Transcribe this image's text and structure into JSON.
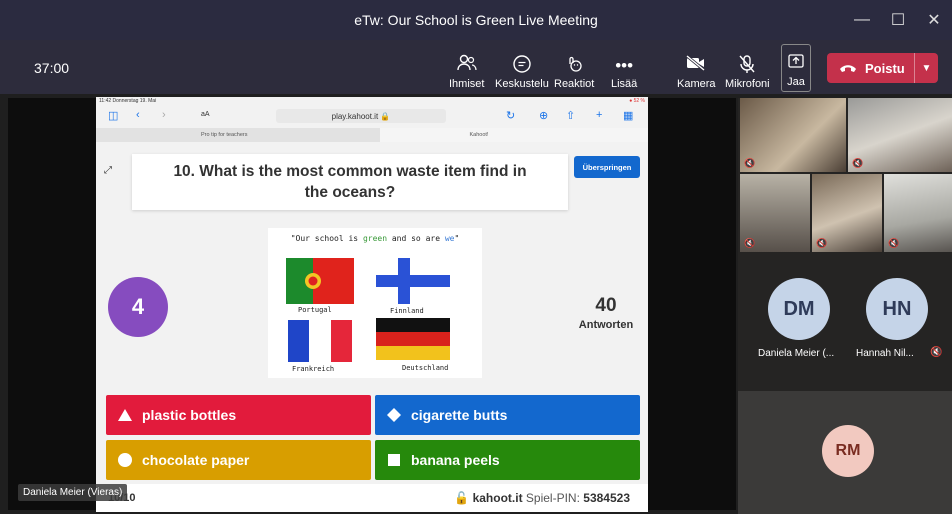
{
  "window": {
    "title": "eTw: Our School is Green Live Meeting",
    "controls": {
      "minimize": "—",
      "maximize": "☐",
      "close": "✕"
    }
  },
  "toolbar": {
    "timer": "37:00",
    "people_label": "Ihmiset",
    "chat_label": "Keskustelu",
    "reactions_label": "Reaktiot",
    "more_label": "Lisää",
    "camera_label": "Kamera",
    "mic_label": "Mikrofoni",
    "share_label": "Jaa",
    "leave_label": "Poistu"
  },
  "ipad": {
    "status_left": "11:42  Donnerstag 19. Mai",
    "status_right": "● 52 %",
    "aa": "aA",
    "url": "play.kahoot.it",
    "tab1": "Pro tip for teachers",
    "tab2": "Kahoot!"
  },
  "quiz": {
    "question": "10. What is the most common waste item find in the oceans?",
    "skip_label": "Überspringen",
    "timer_value": "4",
    "answers_count": "40",
    "answers_label": "Antworten",
    "image": {
      "caption_pre": "\"Our school is ",
      "caption_green": "green",
      "caption_mid": " and so are ",
      "caption_we": "we",
      "caption_post": "\"",
      "flags": [
        "Portugal",
        "Finnland",
        "Frankreich",
        "Deutschland"
      ]
    },
    "answers": [
      {
        "label": "plastic bottles",
        "color": "#e21b3c",
        "shape": "triangle"
      },
      {
        "label": "cigarette butts",
        "color": "#1368ce",
        "shape": "diamond"
      },
      {
        "label": "chocolate paper",
        "color": "#d89e00",
        "shape": "circle"
      },
      {
        "label": "banana peels",
        "color": "#26890c",
        "shape": "square"
      }
    ],
    "footer": {
      "counter": "10/10",
      "site": "kahoot.it",
      "pin_label": "Spiel-PIN:",
      "pin": "5384523"
    }
  },
  "presenter_nameplate": "Daniela Meier (Vieras)",
  "participants": [
    {
      "initials": "DM",
      "name": "Daniela Meier (..."
    },
    {
      "initials": "HN",
      "name": "Hannah Nil..."
    },
    {
      "initials": "RM"
    }
  ]
}
